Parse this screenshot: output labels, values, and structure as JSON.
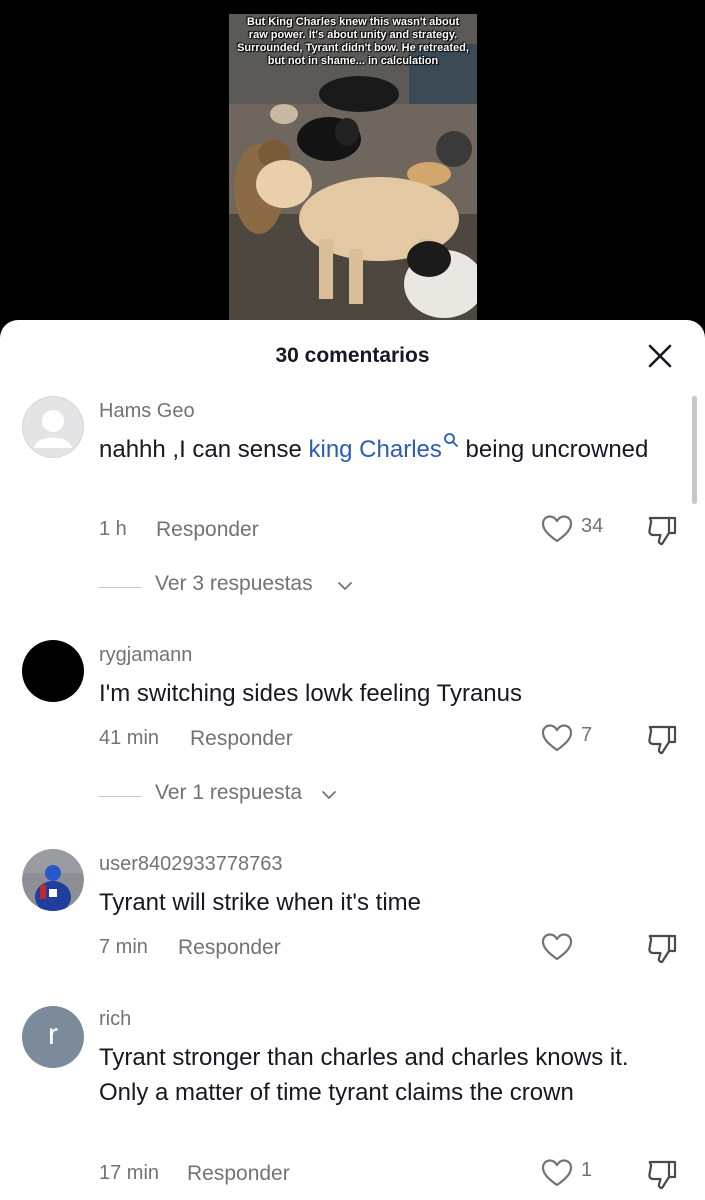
{
  "video": {
    "caption_lines": [
      "But King Charles knew this wasn't about",
      "raw power. It's about unity and strategy.",
      "Surrounded, Tyrant didn't bow. He retreated,",
      "but not in shame... in calculation"
    ]
  },
  "sheet": {
    "title": "30 comentarios"
  },
  "comments": [
    {
      "username": "Hams Geo",
      "text_before": "nahhh ,I can sense ",
      "hashtag": "king Charles",
      "text_after": " being uncrowned",
      "time": "1 h",
      "reply_label": "Responder",
      "likes": "34",
      "replies_label": "Ver 3 respuestas"
    },
    {
      "username": "rygjamann",
      "text": "I'm switching sides lowk feeling Tyranus",
      "time": "41 min",
      "reply_label": "Responder",
      "likes": "7",
      "replies_label": "Ver 1 respuesta"
    },
    {
      "username": "user8402933778763",
      "text": "Tyrant will strike when it's time",
      "time": "7 min",
      "reply_label": "Responder",
      "likes": ""
    },
    {
      "username": "rich",
      "avatar_letter": "r",
      "text": "Tyrant stronger than charles and charles knows it. Only a matter of time tyrant claims the crown",
      "time": "17 min",
      "reply_label": "Responder",
      "likes": "1"
    }
  ],
  "colors": {
    "hashtag": "#2b5db0",
    "meta_text": "#737373",
    "primary_text": "#161823",
    "avatar_letter_bg": "#7c8b99"
  }
}
